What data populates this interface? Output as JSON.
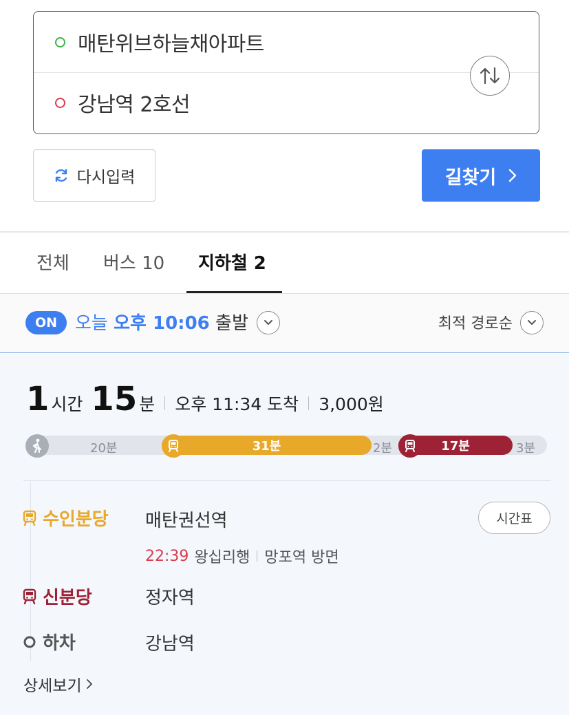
{
  "search": {
    "origin": "매탄위브하늘채아파트",
    "destination": "강남역 2호선",
    "swap_icon": "swap-vertical-arrows-icon"
  },
  "actions": {
    "reset_label": "다시입력",
    "find_label": "길찾기"
  },
  "tabs": [
    {
      "label": "전체"
    },
    {
      "label": "버스 10"
    },
    {
      "label": "지하철 2",
      "active": true
    }
  ],
  "filter": {
    "badge": "ON",
    "depart_prefix": "오늘",
    "depart_time": "오후 10:06",
    "depart_suffix": "출발",
    "sort_label": "최적 경로순"
  },
  "route": {
    "hours": "1",
    "hours_unit": "시간",
    "minutes": "15",
    "minutes_unit": "분",
    "arrival": "오후 11:34 도착",
    "fare": "3,000원",
    "timeline": {
      "walk_start": "20분",
      "line1": "31분",
      "transfer": "2분",
      "line2": "17분",
      "walk_end": "3분"
    },
    "steps": [
      {
        "line": "수인분당",
        "station": "매탄권선역",
        "color": "#e8a82a"
      },
      {
        "line": "신분당",
        "station": "정자역",
        "color": "#9e2236"
      },
      {
        "line": "하차",
        "station": "강남역",
        "color": "#555555"
      }
    ],
    "train": {
      "time": "22:39",
      "direction": "왕십리행",
      "platform": "망포역 방면"
    },
    "timetable_label": "시간표",
    "detail_label": "상세보기"
  },
  "colors": {
    "accent": "#3d7ef1",
    "suin_bundang": "#e8a82a",
    "sinbundang": "#9e2236"
  }
}
